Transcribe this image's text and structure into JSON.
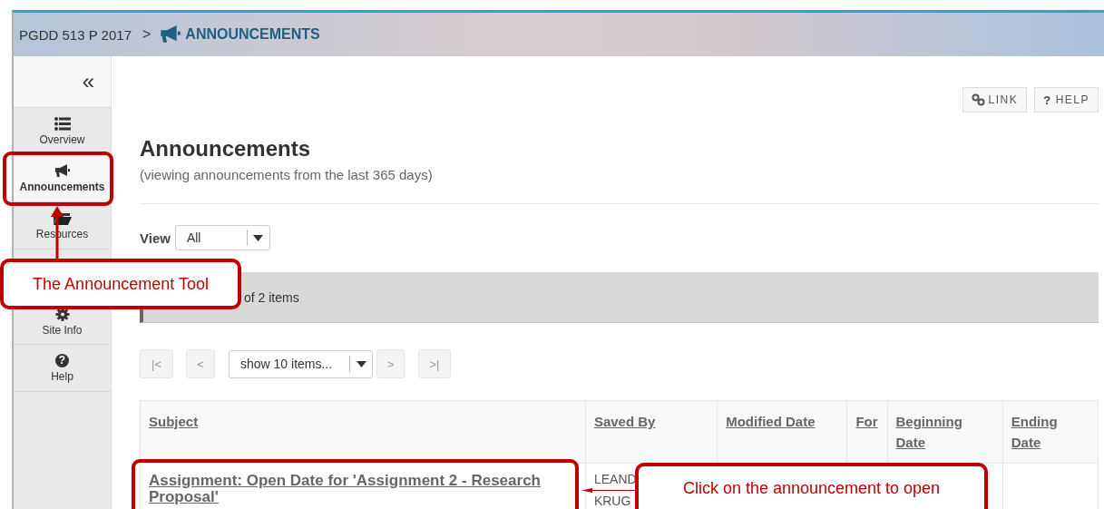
{
  "breadcrumb": {
    "site": "PGDD 513 P 2017",
    "separator": ">",
    "tool": "ANNOUNCEMENTS"
  },
  "sidebar": {
    "collapse": "«",
    "items": [
      {
        "kind": "list",
        "label": "Overview",
        "selected": false
      },
      {
        "kind": "megaphone",
        "label": "Announcements",
        "selected": true
      },
      {
        "kind": "folder",
        "label": "Resources",
        "selected": false
      },
      {
        "kind": "gear",
        "label": "Site Info",
        "selected": false
      },
      {
        "kind": "help",
        "icon": "?",
        "label": "Help",
        "selected": false
      }
    ]
  },
  "toolbar": [
    {
      "kind": "link",
      "label": "LINK"
    },
    {
      "kind": "help",
      "icon": "?",
      "label": "HELP"
    }
  ],
  "title": "Announcements",
  "subtitle": "(viewing announcements from the last 365 days)",
  "view": {
    "label": "View",
    "value": "All"
  },
  "summary": "of 2 items",
  "pager": {
    "before": [
      "|<",
      "<"
    ],
    "page_size": "show 10 items...",
    "after": [
      ">",
      ">|"
    ]
  },
  "table": {
    "columns": [
      "Subject",
      "Saved By",
      "Modified Date",
      "For",
      "Beginning Date",
      "Ending Date"
    ],
    "rows": [
      {
        "subject": "Assignment: Open Date for 'Assignment 2 - Research Proposal'",
        "saved_by": [
          "LEAND",
          "KRUG"
        ]
      }
    ]
  },
  "annotations": [
    {
      "text": "The Announcement Tool"
    },
    {
      "text": "Click on the announcement to open"
    }
  ]
}
